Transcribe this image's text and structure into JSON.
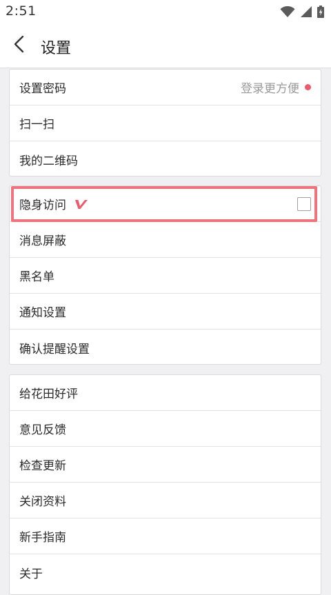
{
  "status_bar": {
    "time": "2:51",
    "icons": [
      "wifi-icon",
      "cellular-icon",
      "battery-charging-icon"
    ]
  },
  "header": {
    "title": "设置",
    "back_icon": "chevron-left-icon"
  },
  "groups": [
    {
      "items": [
        {
          "label": "设置密码",
          "hint": "登录更方便",
          "dot": true
        },
        {
          "label": "扫一扫"
        },
        {
          "label": "我的二维码"
        }
      ]
    },
    {
      "items": [
        {
          "label": "隐身访问",
          "badge": "vip-icon",
          "checkbox": false,
          "highlighted": true
        },
        {
          "label": "消息屏蔽"
        },
        {
          "label": "黑名单"
        },
        {
          "label": "通知设置"
        },
        {
          "label": "确认提醒设置"
        }
      ]
    },
    {
      "items": [
        {
          "label": "给花田好评"
        },
        {
          "label": "意见反馈"
        },
        {
          "label": "检查更新"
        },
        {
          "label": "关闭资料"
        },
        {
          "label": "新手指南"
        },
        {
          "label": "关于"
        }
      ]
    }
  ],
  "colors": {
    "accent_red": "#ef5a6a",
    "highlight_frame": "#f0727c",
    "background": "#f0f0f2"
  }
}
